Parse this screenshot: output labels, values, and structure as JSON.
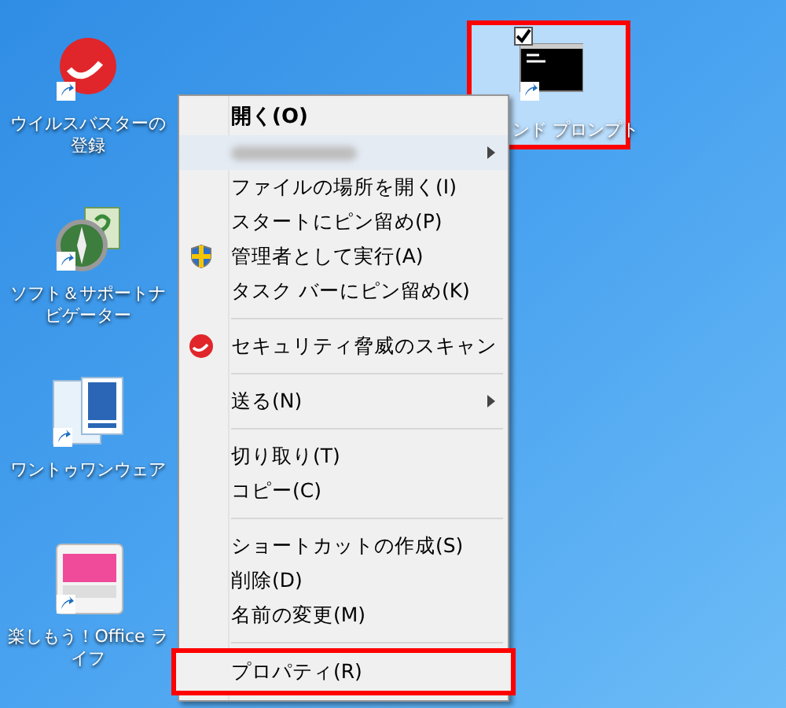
{
  "desktop_icons": [
    {
      "label": "ウイルスバスターの登録",
      "kind": "virus"
    },
    {
      "label": "ソフト＆サポートナビゲーター",
      "kind": "compass"
    },
    {
      "label": "ワントゥワンウェア",
      "kind": "ware"
    },
    {
      "label": "楽しもう！Office ライフ",
      "kind": "office"
    }
  ],
  "selected_icon": {
    "label": "ンド プロンプト",
    "checked": true,
    "highlighted": true
  },
  "context_menu": {
    "items": [
      {
        "kind": "item",
        "label": "開く(O)",
        "default": true,
        "submenu": false,
        "hovered": false,
        "highlighted": false
      },
      {
        "kind": "blurred",
        "submenu": true,
        "hovered": true,
        "highlighted": false
      },
      {
        "kind": "item",
        "label": "ファイルの場所を開く(I)",
        "default": false,
        "submenu": false,
        "hovered": false,
        "highlighted": false
      },
      {
        "kind": "item",
        "label": "スタートにピン留め(P)",
        "default": false,
        "submenu": false,
        "hovered": false,
        "highlighted": false
      },
      {
        "kind": "admin",
        "label": "管理者として実行(A)",
        "default": false,
        "submenu": false,
        "hovered": false,
        "highlighted": false
      },
      {
        "kind": "item",
        "label": "タスク バーにピン留め(K)",
        "default": false,
        "submenu": false,
        "hovered": false,
        "highlighted": false
      },
      {
        "kind": "separator"
      },
      {
        "kind": "scan",
        "label": "セキュリティ脅威のスキャン",
        "default": false,
        "submenu": false,
        "hovered": false,
        "highlighted": false
      },
      {
        "kind": "separator"
      },
      {
        "kind": "item",
        "label": "送る(N)",
        "default": false,
        "submenu": true,
        "hovered": false,
        "highlighted": false
      },
      {
        "kind": "separator"
      },
      {
        "kind": "item",
        "label": "切り取り(T)",
        "default": false,
        "submenu": false,
        "hovered": false,
        "highlighted": false
      },
      {
        "kind": "item",
        "label": "コピー(C)",
        "default": false,
        "submenu": false,
        "hovered": false,
        "highlighted": false
      },
      {
        "kind": "separator"
      },
      {
        "kind": "item",
        "label": "ショートカットの作成(S)",
        "default": false,
        "submenu": false,
        "hovered": false,
        "highlighted": false
      },
      {
        "kind": "item",
        "label": "削除(D)",
        "default": false,
        "submenu": false,
        "hovered": false,
        "highlighted": false
      },
      {
        "kind": "item",
        "label": "名前の変更(M)",
        "default": false,
        "submenu": false,
        "hovered": false,
        "highlighted": false
      },
      {
        "kind": "separator"
      },
      {
        "kind": "item",
        "label": "プロパティ(R)",
        "default": false,
        "submenu": false,
        "hovered": false,
        "highlighted": true
      }
    ]
  }
}
